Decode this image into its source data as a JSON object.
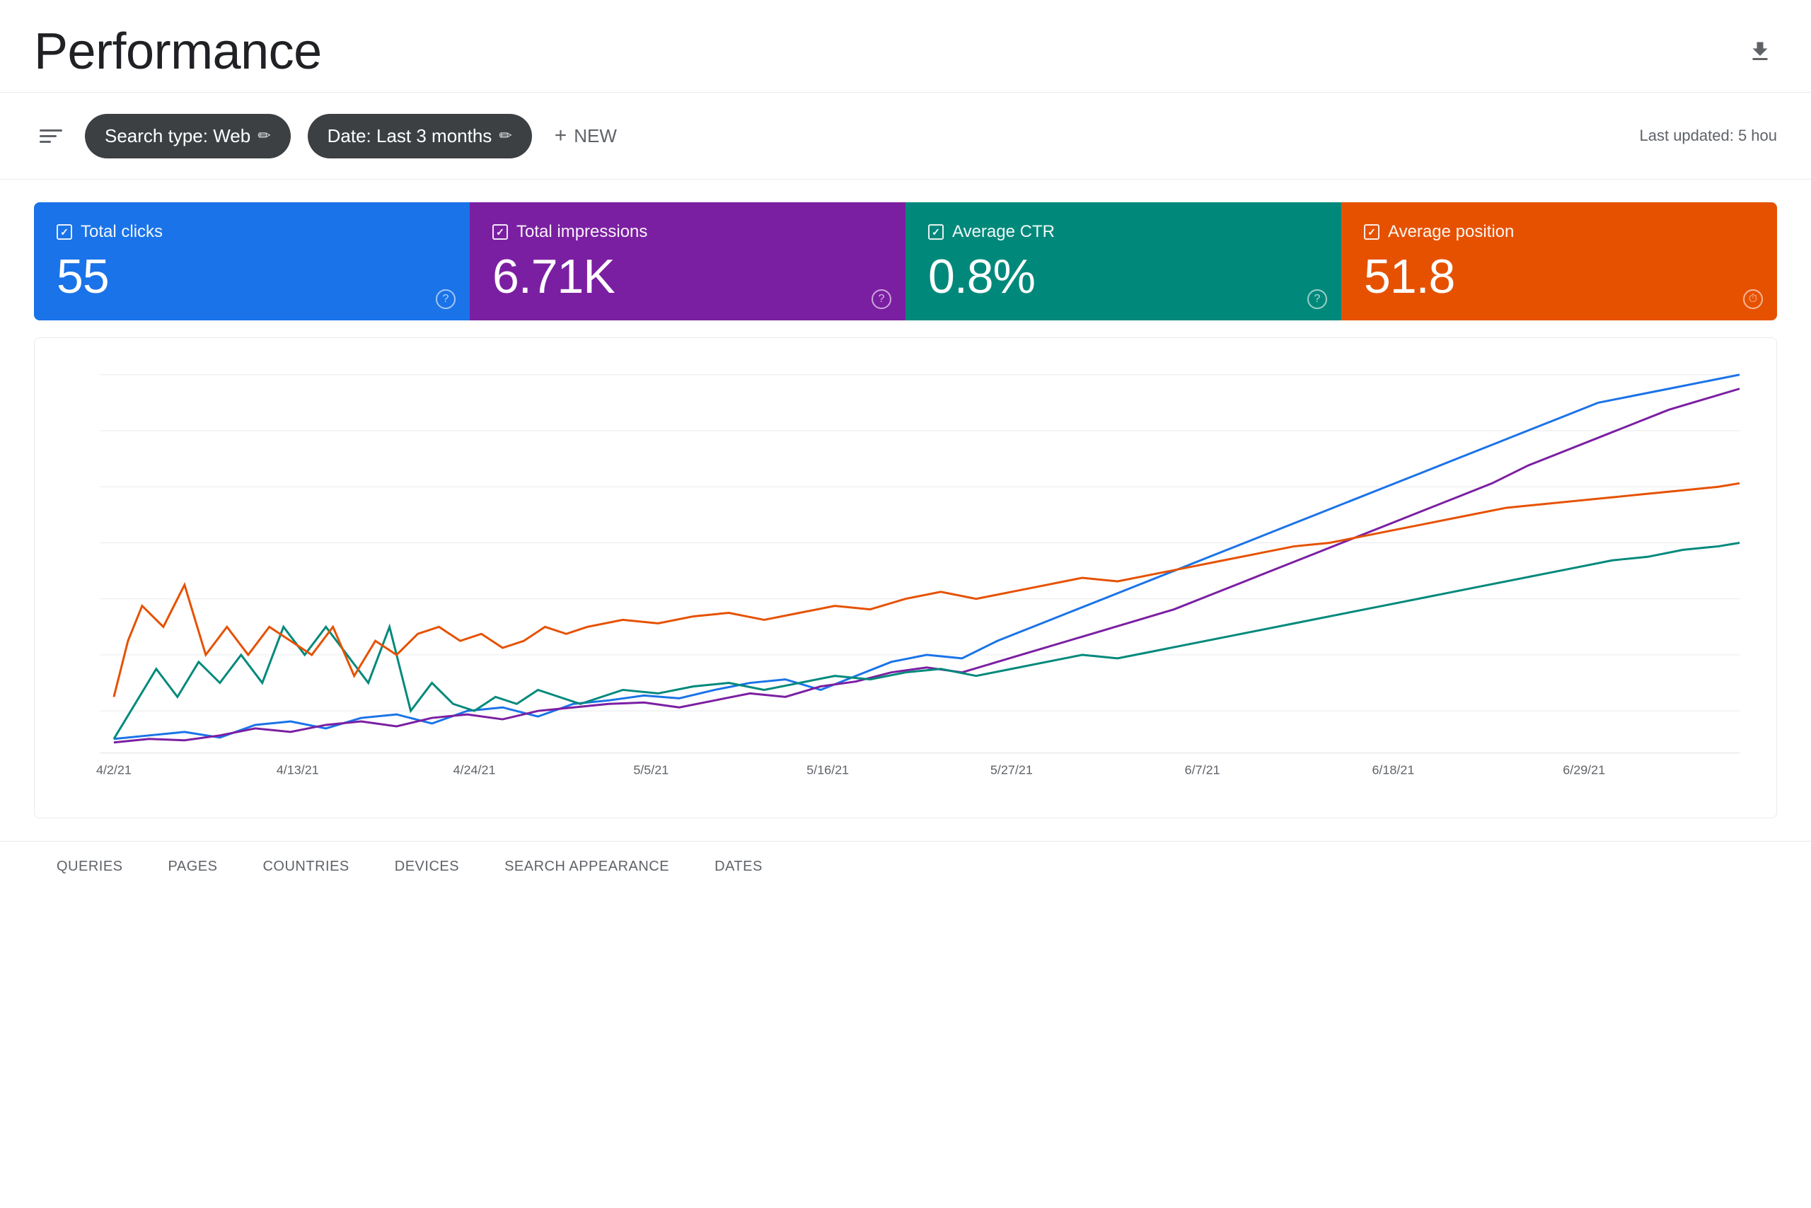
{
  "header": {
    "title": "Performance",
    "last_updated": "Last updated: 5 hou"
  },
  "toolbar": {
    "search_type_label": "Search type: Web",
    "date_label": "Date: Last 3 months",
    "new_label": "NEW",
    "edit_icon": "✏"
  },
  "metrics": [
    {
      "id": "total-clicks",
      "label": "Total clicks",
      "value": "55",
      "color": "blue"
    },
    {
      "id": "total-impressions",
      "label": "Total impressions",
      "value": "6.71K",
      "color": "purple"
    },
    {
      "id": "average-ctr",
      "label": "Average CTR",
      "value": "0.8%",
      "color": "teal"
    },
    {
      "id": "average-position",
      "label": "Average position",
      "value": "51.8",
      "color": "orange"
    }
  ],
  "chart": {
    "x_labels": [
      "4/2/21",
      "4/13/21",
      "4/24/21",
      "5/5/21",
      "5/16/21",
      "5/27/21",
      "6/7/21",
      "6/18/21",
      "6/29/21"
    ]
  },
  "tabs": [
    {
      "id": "queries",
      "label": "QUERIES"
    },
    {
      "id": "pages",
      "label": "PAGES"
    },
    {
      "id": "countries",
      "label": "COUNTRIES"
    },
    {
      "id": "devices",
      "label": "DEVICES"
    },
    {
      "id": "search-appearance",
      "label": "SEARCH APPEARANCE"
    },
    {
      "id": "dates",
      "label": "DATES"
    }
  ]
}
